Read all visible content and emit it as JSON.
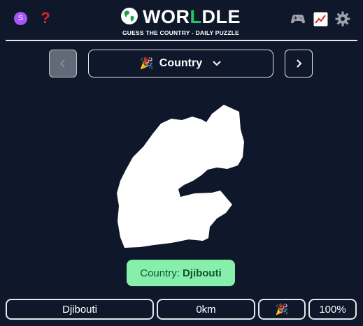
{
  "header": {
    "avatar_letter": "S",
    "help_glyph": "?",
    "logo_prefix": "WOR",
    "logo_accent": "L",
    "logo_suffix": "DLE",
    "subtitle": "GUESS THE COUNTRY - DAILY PUZZLE",
    "icons": [
      "user-avatar",
      "help-icon",
      "globe-icon",
      "controller-icon",
      "stats-icon",
      "settings-icon"
    ]
  },
  "game_nav": {
    "prev_glyph": "‹",
    "next_glyph": "›",
    "selector_emoji": "🎉",
    "selector_label": "Country"
  },
  "answer": {
    "label": "Country:",
    "value": "Djibouti"
  },
  "guess_row": {
    "country": "Djibouti",
    "distance": "0km",
    "direction_emoji": "🎉",
    "proximity": "100%"
  },
  "colors": {
    "background": "#0f172a",
    "accent_green": "#22c55e",
    "answer_bg": "#86efac",
    "help_red": "#dc2626",
    "avatar_purple": "#a855f7"
  }
}
